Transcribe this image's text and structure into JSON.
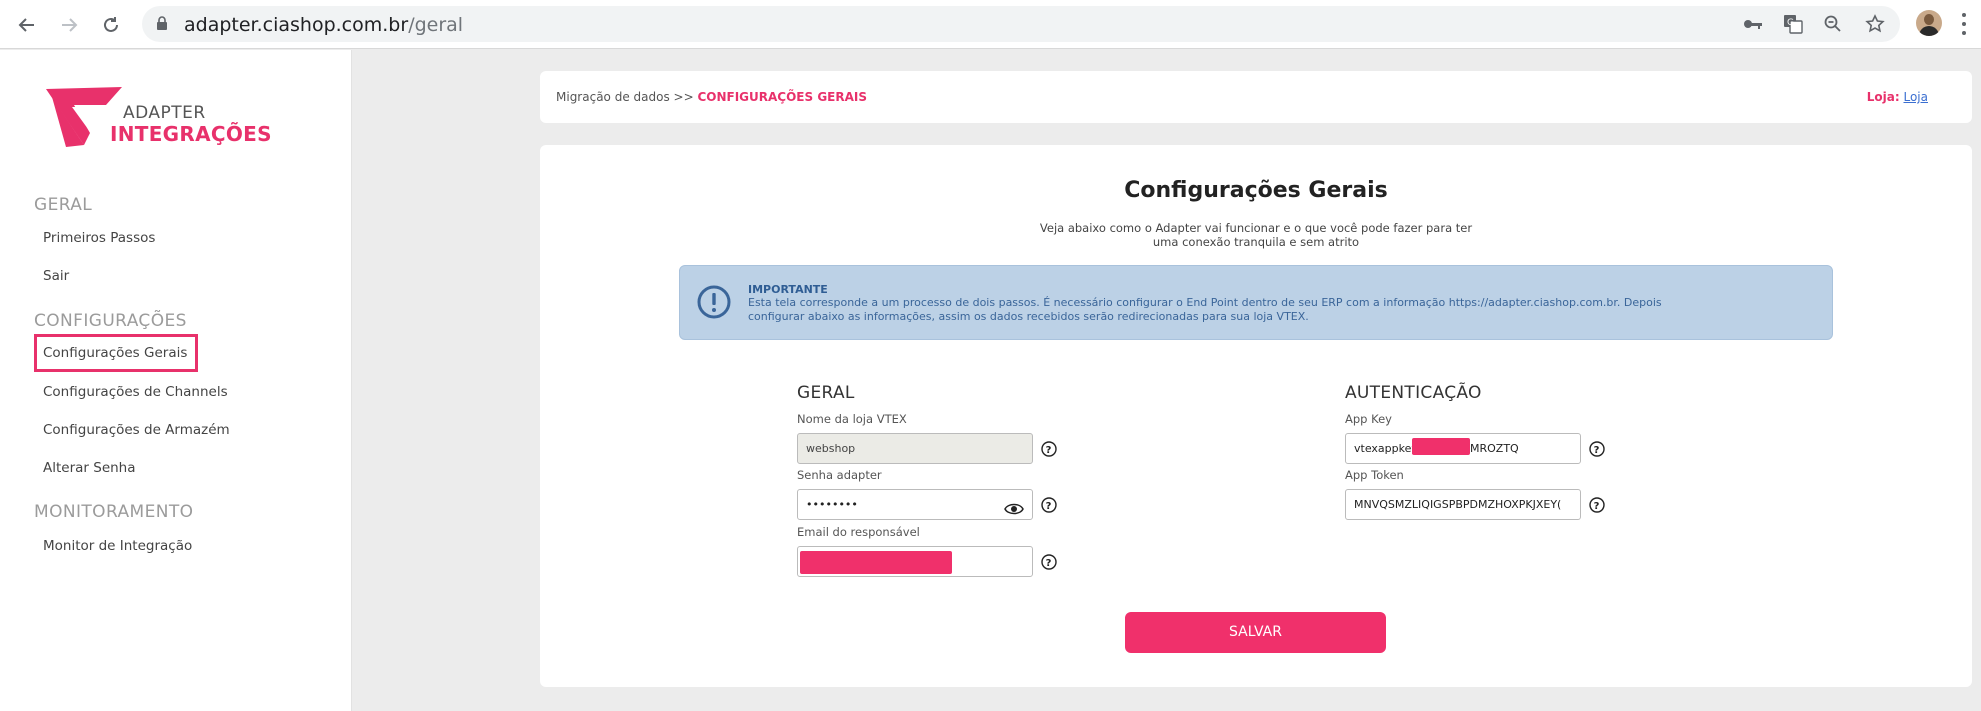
{
  "browser": {
    "url_domain": "adapter.ciashop.com.br",
    "url_path": "/geral"
  },
  "sidebar": {
    "logo": {
      "line1": "ADAPTER",
      "line2": "INTEGRAÇÕES"
    },
    "sections": [
      {
        "title": "GERAL",
        "items": [
          "Primeiros Passos",
          "Sair"
        ]
      },
      {
        "title": "CONFIGURAÇÕES",
        "items": [
          "Configurações Gerais",
          "Configurações de Channels",
          "Configurações de Armazém",
          "Alterar Senha"
        ]
      },
      {
        "title": "MONITORAMENTO",
        "items": [
          "Monitor de Integração"
        ]
      }
    ]
  },
  "breadcrumb": {
    "parent": "Migração de dados >>",
    "current": "CONFIGURAÇÕES GERAIS",
    "store_label": "Loja:",
    "store_link": "Loja"
  },
  "main": {
    "title": "Configurações Gerais",
    "subtitle_line1": "Veja abaixo como o Adapter vai funcionar e o que você pode fazer para ter",
    "subtitle_line2": "uma conexão tranquila e sem atrito",
    "alert": {
      "title": "IMPORTANTE",
      "text": "Esta tela corresponde a um processo de dois passos. É necessário configurar o End Point dentro de seu ERP com a informação https://adapter.ciashop.com.br. Depois configurar abaixo as informações, assim os dados recebidos serão redirecionadas para sua loja VTEX."
    },
    "geral": {
      "title": "GERAL",
      "store_name_label": "Nome da loja VTEX",
      "store_name_value": "webshop",
      "password_label": "Senha adapter",
      "password_value": "••••••••",
      "email_label": "Email do responsável"
    },
    "auth": {
      "title": "AUTENTICAÇÃO",
      "app_key_label": "App Key",
      "app_key_prefix": "vtexappkey",
      "app_key_suffix": "MROZTQ",
      "app_token_label": "App Token",
      "app_token_value": "MNVQSMZLIQIGSPBPDMZHOXPKJXEY("
    },
    "save_label": "SALVAR"
  },
  "colors": {
    "brand": "#e8316b",
    "button": "#f0306b",
    "alert_bg": "#bcd1e6",
    "alert_text": "#3a6599"
  }
}
